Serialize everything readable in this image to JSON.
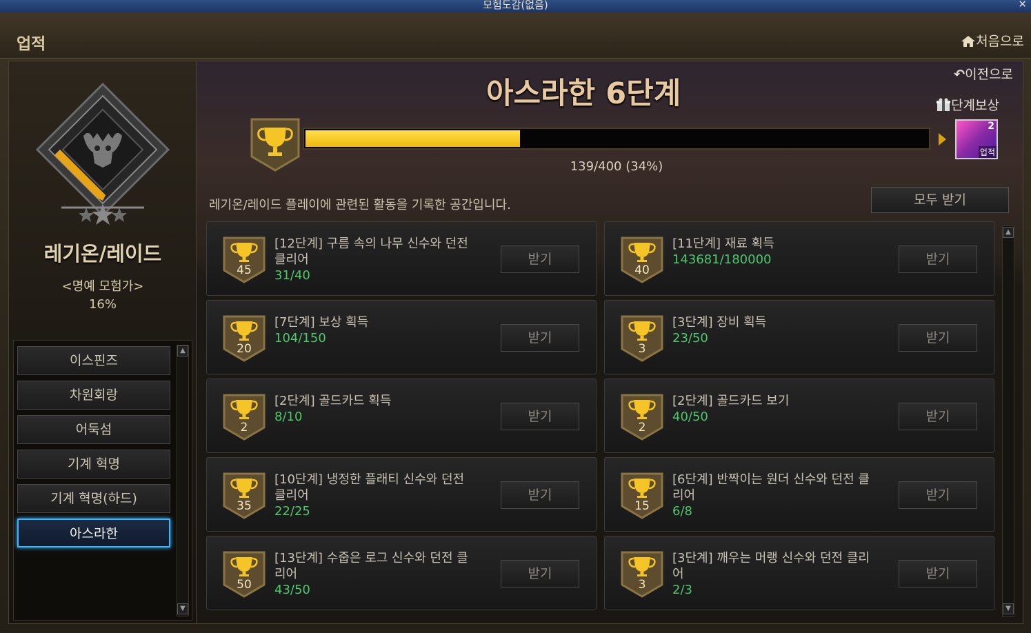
{
  "window": {
    "title": "모험도감(없음)",
    "close": "✕"
  },
  "header": {
    "title": "업적",
    "home_label": "처음으로"
  },
  "category": {
    "title": "레기온/레이드",
    "honor": "<명예 모험가>",
    "percent": "16%"
  },
  "sidebar": {
    "items": [
      {
        "label": "이스핀즈",
        "active": false
      },
      {
        "label": "차원회랑",
        "active": false
      },
      {
        "label": "어둑섬",
        "active": false
      },
      {
        "label": "기계 혁명",
        "active": false
      },
      {
        "label": "기계 혁명(하드)",
        "active": false
      },
      {
        "label": "아스라한",
        "active": true
      }
    ]
  },
  "stage": {
    "title": "아스라한 6단계",
    "back_label": "이전으로",
    "reward_label": "단계보상",
    "reward_count": "2",
    "reward_badge": "업적",
    "progress_text": "139/400 (34%)",
    "progress_fraction": 0.3475,
    "description": "레기온/레이드 플레이에 관련된 활동을 기록한 공간입니다.",
    "receive_all": "모두 받기"
  },
  "achievements": [
    {
      "title": "[12단계] 구름 속의 나무 신수와 던전 클리어",
      "progress": "31/40",
      "points": "45",
      "button": "받기"
    },
    {
      "title": "[11단계] 재료 획득",
      "progress": "143681/180000",
      "points": "40",
      "button": "받기"
    },
    {
      "title": "[7단계] 보상 획득",
      "progress": "104/150",
      "points": "20",
      "button": "받기"
    },
    {
      "title": "[3단계] 장비 획득",
      "progress": "23/50",
      "points": "3",
      "button": "받기"
    },
    {
      "title": "[2단계] 골드카드 획득",
      "progress": "8/10",
      "points": "2",
      "button": "받기"
    },
    {
      "title": "[2단계] 골드카드 보기",
      "progress": "40/50",
      "points": "2",
      "button": "받기"
    },
    {
      "title": "[10단계] 냉정한 플래티 신수와 던전 클리어",
      "progress": "22/25",
      "points": "35",
      "button": "받기"
    },
    {
      "title": "[6단계] 반짝이는 원더 신수와 던전 클리어",
      "progress": "6/8",
      "points": "15",
      "button": "받기"
    },
    {
      "title": "[13단계] 수줍은 로그 신수와 던전 클리어",
      "progress": "43/50",
      "points": "50",
      "button": "받기"
    },
    {
      "title": "[3단계] 깨우는 머랭 신수와 던전 클리어",
      "progress": "2/3",
      "points": "3",
      "button": "받기"
    }
  ],
  "colors": {
    "accent_gold": "#f0b80c",
    "progress_green": "#4cc96a",
    "active_blue": "#3ab5ff"
  }
}
